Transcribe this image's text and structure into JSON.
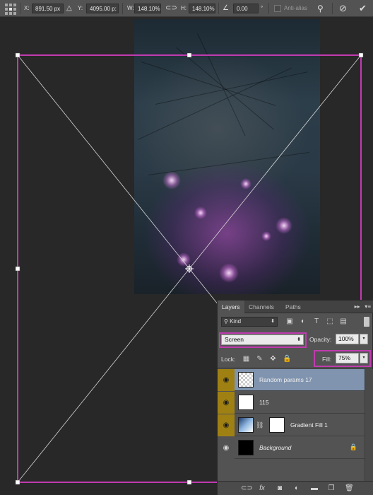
{
  "options_bar": {
    "x_label": "X:",
    "x_value": "891.50 px",
    "y_label": "Y:",
    "y_value": "4095.00 p:",
    "w_label": "W:",
    "w_value": "148.10%",
    "h_label": "H:",
    "h_value": "148.10%",
    "angle_value": "0.00",
    "degree_symbol": "°",
    "anti_alias_label": "Anti-alias",
    "cancel_icon": "cancel-transform-icon",
    "commit_icon": "commit-transform-icon"
  },
  "layers_panel": {
    "tabs": [
      {
        "label": "Layers",
        "active": true
      },
      {
        "label": "Channels",
        "active": false
      },
      {
        "label": "Paths",
        "active": false
      }
    ],
    "filter_kind": "Kind",
    "blend_mode": "Screen",
    "opacity_label": "Opacity:",
    "opacity_value": "100%",
    "lock_label": "Lock:",
    "fill_label": "Fill:",
    "fill_value": "75%",
    "layers": [
      {
        "name": "Random params 17",
        "selected": true,
        "visible": true
      },
      {
        "name": "115",
        "selected": false,
        "visible": true
      },
      {
        "name": "Gradient Fill 1",
        "selected": false,
        "visible": true
      },
      {
        "name": "Background",
        "selected": false,
        "visible": true,
        "locked": true
      }
    ],
    "footer_icons": [
      "link-layers-icon",
      "fx-icon",
      "add-mask-icon",
      "adjustment-layer-icon",
      "new-group-icon",
      "new-layer-icon",
      "trash-icon"
    ]
  },
  "colors": {
    "highlight": "#c13bb0",
    "visibility_bg": "#9f8113",
    "selected_layer": "#8094af"
  }
}
